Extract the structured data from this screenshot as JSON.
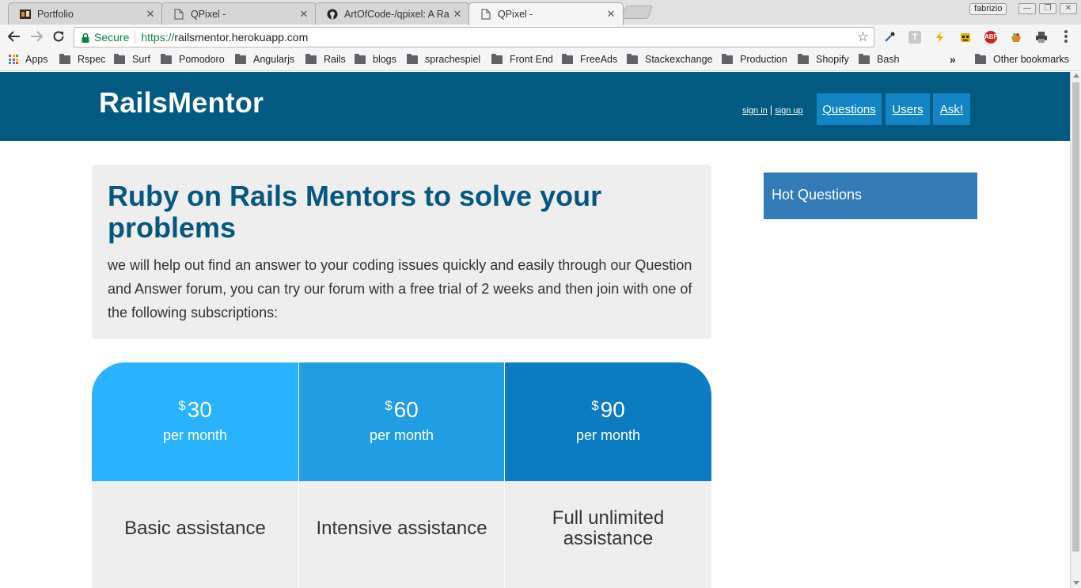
{
  "browser": {
    "tabs": [
      {
        "title": "Portfolio",
        "active": false
      },
      {
        "title": "QPixel -",
        "active": false
      },
      {
        "title": "ArtOfCode-/qpixel: A Ra",
        "active": false
      },
      {
        "title": "QPixel -",
        "active": true
      }
    ],
    "profile_name": "fabrizio",
    "secure_label": "Secure",
    "url_scheme": "https://",
    "url_host": "railsmentor.herokuapp.com",
    "bookmarks": [
      "Apps",
      "Rspec",
      "Surf",
      "Pomodoro",
      "Angularjs",
      "Rails",
      "blogs",
      "sprachespiel",
      "Front End",
      "FreeAds",
      "Stackexchange",
      "Production",
      "Shopify",
      "Bash"
    ],
    "overflow_chevron": "»",
    "other_bookmarks": "Other bookmarks",
    "extensions": [
      "eyedropper-icon",
      "t-icon",
      "lightning-icon",
      "robot-icon",
      "abp-icon",
      "basket-icon",
      "printer-icon"
    ],
    "ext_abp_label": "ABP",
    "ext_t_label": "T"
  },
  "site": {
    "brand": "RailsMentor",
    "auth": {
      "sign_in": "sign in",
      "pipe": "|",
      "sign_up": "sign up"
    },
    "nav": [
      {
        "label": "Questions"
      },
      {
        "label": "Users"
      },
      {
        "label": "Ask!"
      }
    ],
    "colors": {
      "header": "#025a80",
      "nav_button": "#1385c4",
      "heading": "#05577f",
      "sidebar_box": "#337ab7"
    }
  },
  "hero": {
    "heading": "Ruby on Rails Mentors to solve your problems",
    "body": "we will help out find an answer to your coding issues quickly and easily through our Question and Answer forum, you can try our forum with a free trial of 2 weeks and then join with one of the following subscriptions:"
  },
  "pricing": {
    "currency": "$",
    "plans": [
      {
        "amount": "30",
        "period": "per month",
        "feature": "Basic assistance",
        "color": "#29b2fe"
      },
      {
        "amount": "60",
        "period": "per month",
        "feature": "Intensive assistance",
        "color": "#219de3"
      },
      {
        "amount": "90",
        "period": "per month",
        "feature": "Full unlimited assistance",
        "color": "#0b7cc1"
      }
    ]
  },
  "sidebar": {
    "hot_questions_title": "Hot Questions"
  }
}
